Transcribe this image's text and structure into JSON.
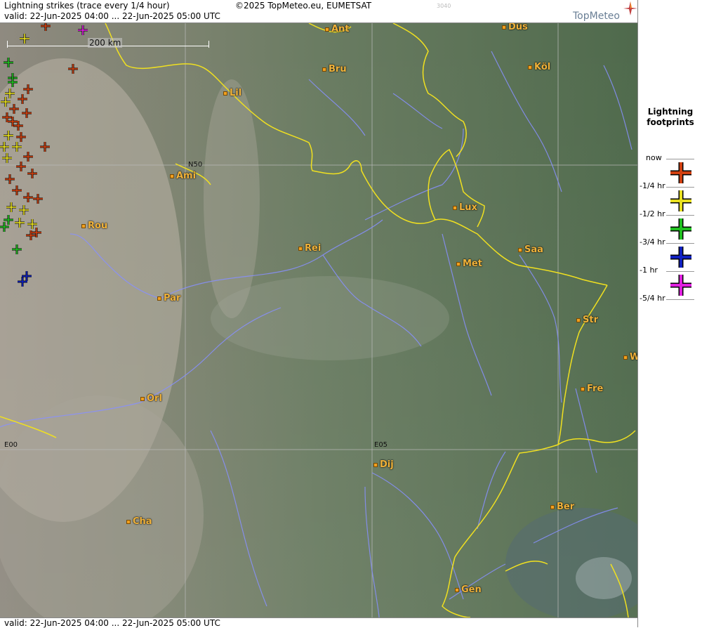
{
  "header": {
    "title": "Lightning strikes (trace every 1/4 hour)",
    "valid": "valid:  22-Jun-2025 04:00 ... 22-Jun-2025 05:00 UTC",
    "copyright": "©2025 TopMeteo.eu, EUMETSAT",
    "code": "3040",
    "brand": "TopMeteo"
  },
  "footer": {
    "valid": "valid:  22-Jun-2025 04:00 ... 22-Jun-2025 05:00 UTC"
  },
  "map": {
    "scale_label": "200 km",
    "grid_labels": {
      "n50": "N50",
      "e00": "E00",
      "e05": "E05"
    },
    "cities": [
      {
        "name": "Ant"
      },
      {
        "name": "Düs"
      },
      {
        "name": "Bru"
      },
      {
        "name": "Köl"
      },
      {
        "name": "Lil"
      },
      {
        "name": "Ami"
      },
      {
        "name": "Lux"
      },
      {
        "name": "Rou"
      },
      {
        "name": "Rei"
      },
      {
        "name": "Saa"
      },
      {
        "name": "Met"
      },
      {
        "name": "Par"
      },
      {
        "name": "Str"
      },
      {
        "name": "W"
      },
      {
        "name": "Fre"
      },
      {
        "name": "Orl"
      },
      {
        "name": "Dij"
      },
      {
        "name": "Ber"
      },
      {
        "name": "Cha"
      },
      {
        "name": "Gen"
      }
    ]
  },
  "legend": {
    "title_line1": "Lightning",
    "title_line2": "footprints",
    "entries": [
      {
        "label": "now",
        "color": "#d04010"
      },
      {
        "label": "-1/4 hr",
        "color": "#e8e020"
      },
      {
        "label": "-1/2 hr",
        "color": "#20c020"
      },
      {
        "label": "-3/4 hr",
        "color": "#1020c0"
      },
      {
        "label": "-1 hr",
        "color": "#e020e0"
      },
      {
        "label": "-5/4 hr",
        "color": ""
      }
    ]
  },
  "colors": {
    "border": "#f0e020",
    "river": "#8890ff",
    "city": "#f0b23a"
  }
}
